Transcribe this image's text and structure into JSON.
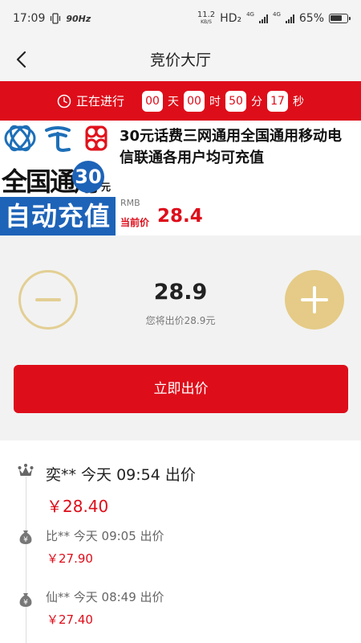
{
  "status_bar": {
    "time": "17:09",
    "refresh_rate": "90Hz",
    "net_speed": "11.2",
    "net_unit": "KB/S",
    "hd": "HD₂",
    "net_type_1": "4G",
    "net_type_2": "4G",
    "battery": "65%"
  },
  "header": {
    "title": "竞价大厅",
    "back_icon": "chevron-left-icon"
  },
  "countdown": {
    "label": "正在进行",
    "days": "00",
    "days_unit": "天",
    "hours": "00",
    "hours_unit": "时",
    "minutes": "50",
    "minutes_unit": "分",
    "seconds": "17",
    "seconds_unit": "秒"
  },
  "product": {
    "title": "30元话费三网通用全国通用移动电信联通各用户均可充值",
    "image": {
      "line1": "全国通用",
      "amount": "30",
      "amount_unit": "元",
      "line2": "自动充值",
      "logos": [
        "china-mobile-logo",
        "china-telecom-logo",
        "china-unicom-logo"
      ]
    },
    "currency": "RMB",
    "current_price_label": "当前价",
    "current_price": "28.4"
  },
  "bid": {
    "value": "28.9",
    "hint": "您将出价28.9元",
    "submit_label": "立即出价"
  },
  "history": [
    {
      "who": "奕** 今天 09:54 出价",
      "amount": "￥28.40",
      "icon": "crown-icon"
    },
    {
      "who": "比** 今天 09:05 出价",
      "amount": "￥27.90",
      "icon": "yen-bag-icon"
    },
    {
      "who": "仙** 今天 08:49 出价",
      "amount": "￥27.40",
      "icon": "yen-bag-icon"
    }
  ],
  "colors": {
    "accent": "#de0d1a",
    "gold": "#e5cb87",
    "brand_blue": "#1d63b8"
  }
}
